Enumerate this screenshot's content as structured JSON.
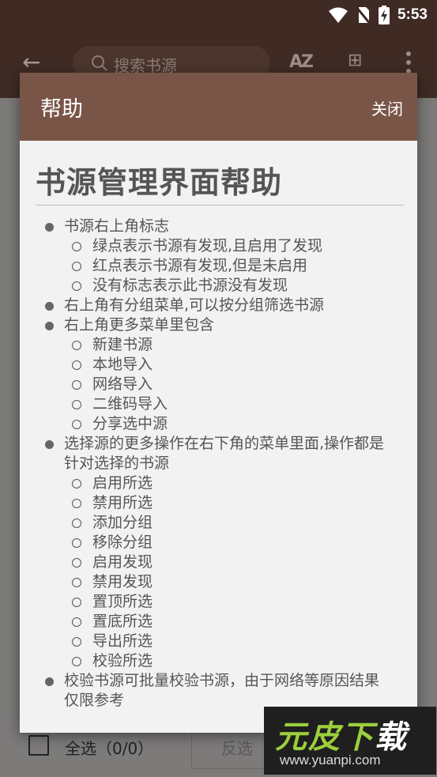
{
  "status_bar": {
    "time": "5:53",
    "icons": [
      "wifi-icon",
      "no-sim-icon",
      "battery-charging-icon"
    ]
  },
  "app_bar": {
    "back_icon": "arrow-left-icon",
    "search_placeholder": "搜索书源",
    "sort_label": "AZ",
    "group_icon": "group-filter-icon",
    "more_icon": "more-vert-icon"
  },
  "bottom_bar": {
    "select_all": "全选（0/0）",
    "invert": "反选"
  },
  "dialog": {
    "title": "帮助",
    "close": "关闭",
    "doc_title": "书源管理界面帮助",
    "items": [
      {
        "text": "书源右上角标志",
        "children": [
          "绿点表示书源有发现,且启用了发现",
          "红点表示书源有发现,但是未启用",
          "没有标志表示此书源没有发现"
        ]
      },
      {
        "text": "右上角有分组菜单,可以按分组筛选书源",
        "children": []
      },
      {
        "text": "右上角更多菜单里包含",
        "children": [
          "新建书源",
          "本地导入",
          "网络导入",
          "二维码导入",
          "分享选中源"
        ]
      },
      {
        "text": "选择源的更多操作在右下角的菜单里面,操作都是针对选择的书源",
        "children": [
          "启用所选",
          "禁用所选",
          "添加分组",
          "移除分组",
          "启用发现",
          "禁用发现",
          "置顶所选",
          "置底所选",
          "导出所选",
          "校验所选"
        ]
      },
      {
        "text": "校验书源可批量校验书源，由于网络等原因结果仅限参考",
        "children": []
      }
    ]
  },
  "watermark": {
    "logo_main": "元皮下",
    "logo_last": "载",
    "url": "www.yuanpi.com"
  }
}
